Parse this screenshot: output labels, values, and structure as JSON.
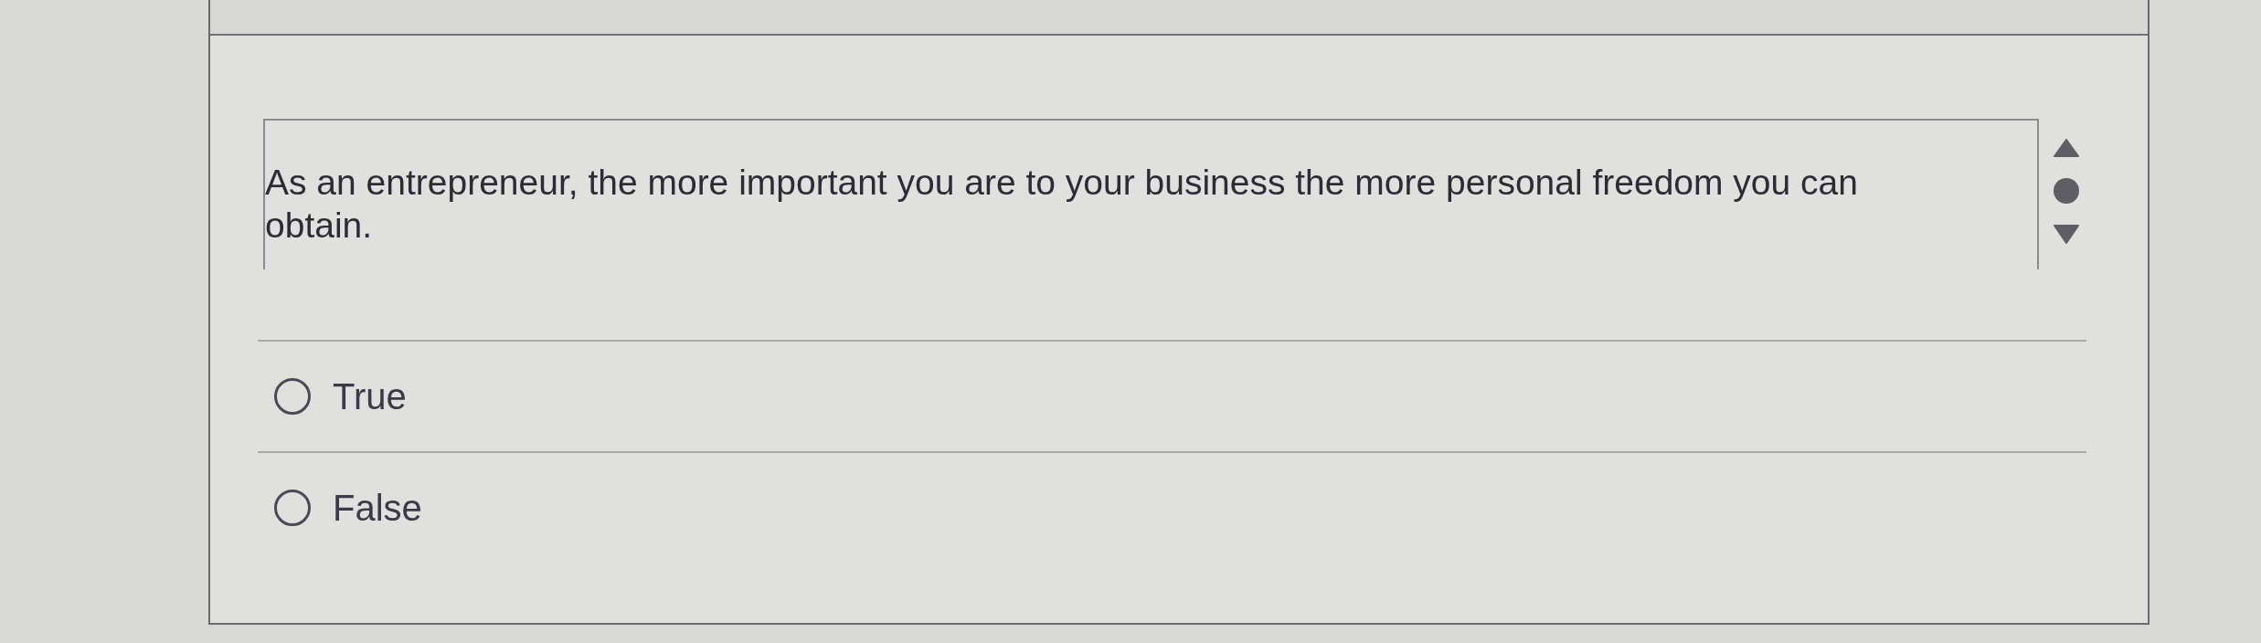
{
  "question": {
    "text": "As an entrepreneur, the more important you are to your business the more personal freedom you can obtain."
  },
  "options": [
    {
      "label": "True",
      "selected": false
    },
    {
      "label": "False",
      "selected": false
    }
  ]
}
